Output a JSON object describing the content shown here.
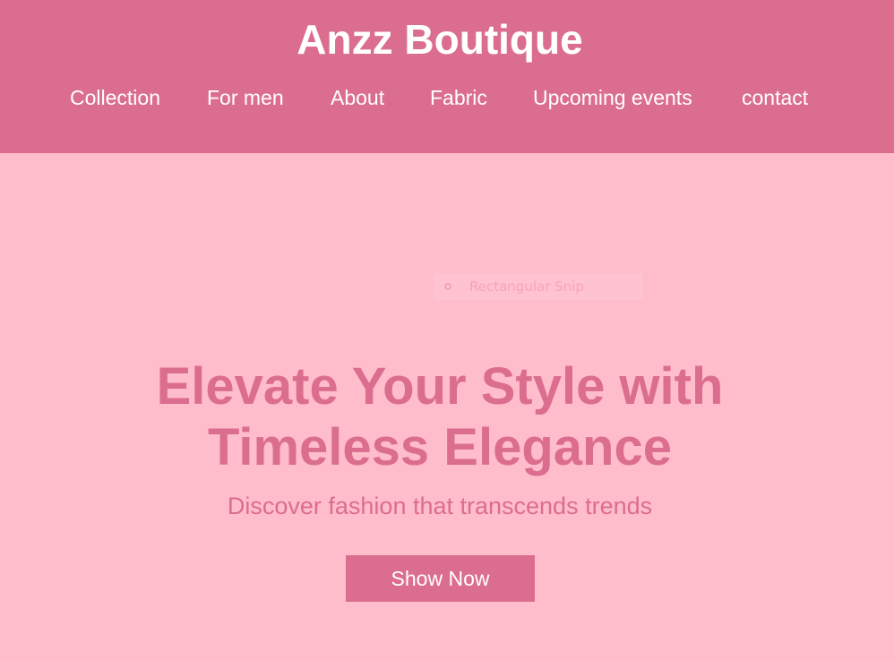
{
  "header": {
    "brand": "Anzz Boutique",
    "nav": [
      {
        "label": "Collection"
      },
      {
        "label": "For men"
      },
      {
        "label": "About"
      },
      {
        "label": "Fabric"
      },
      {
        "label": "Upcoming events"
      },
      {
        "label": "contact"
      }
    ]
  },
  "overlay": {
    "snip_label": "Rectangular Snip",
    "icon": "scissors-icon"
  },
  "hero": {
    "title_line1": "Elevate Your Style with",
    "title_line2": "Timeless Elegance",
    "subtitle": "Discover fashion that transcends trends",
    "cta_label": "Show Now"
  },
  "colors": {
    "header_bg": "#db6e8f",
    "hero_bg": "#ffbccb",
    "accent": "#db6e8f",
    "text_light": "#ffffff"
  }
}
